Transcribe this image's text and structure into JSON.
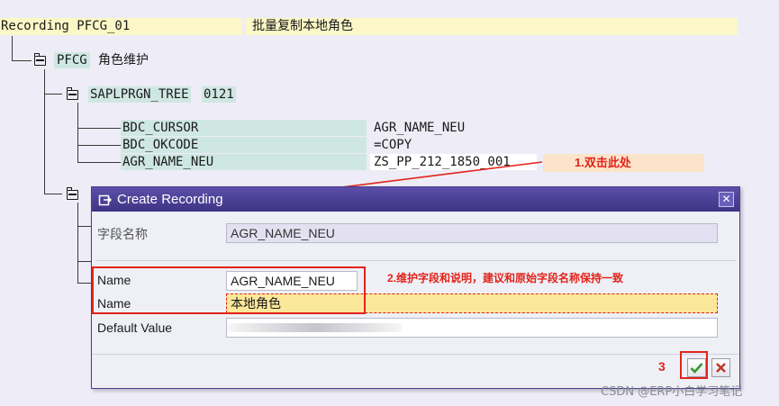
{
  "recording": {
    "title": "Recording PFCG_01",
    "description": "批量复制本地角色"
  },
  "tree": {
    "root": {
      "code": "PFCG",
      "desc": "角色维护"
    },
    "screen": {
      "program": "SAPLPRGN_TREE",
      "number": "0121"
    },
    "fields": [
      {
        "name": "BDC_CURSOR",
        "value": "AGR_NAME_NEU"
      },
      {
        "name": "BDC_OKCODE",
        "value": "=COPY"
      },
      {
        "name": "AGR_NAME_NEU",
        "value": "ZS_PP_212_1850_001"
      }
    ]
  },
  "dialog": {
    "title": "Create Recording",
    "rows": [
      {
        "label": "字段名称",
        "value": "AGR_NAME_NEU"
      },
      {
        "label": "Name",
        "value": "AGR_NAME_NEU"
      },
      {
        "label": "Name",
        "value": "本地角色"
      },
      {
        "label": "Default Value",
        "value": ""
      }
    ]
  },
  "annotations": {
    "step1": "1.双击此处",
    "step2": "2.维护字段和说明，建议和原始字段名称保持一致",
    "step3": "3"
  },
  "watermark": "CSDN @ERP小白学习笔记",
  "colors": {
    "background": "#eeedf7",
    "title_bar": "#4a3f94",
    "annotation": "#e2231a",
    "highlight_yellow": "#fbf7c6",
    "highlight_teal": "#cfe7e2"
  }
}
